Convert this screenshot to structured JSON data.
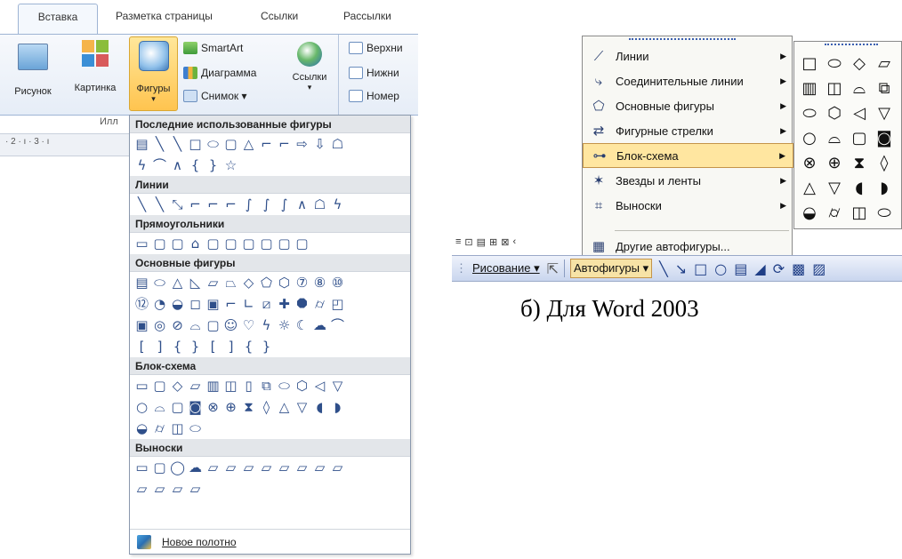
{
  "word2007": {
    "tabs": [
      "Вставка",
      "Разметка страницы",
      "Ссылки",
      "Рассылки"
    ],
    "ribbon": {
      "picture": "Рисунок",
      "clipart": "Картинка",
      "shapes": "Фигуры",
      "smartart": "SmartArt",
      "chart": "Диаграмма",
      "screenshot": "Снимок ▾",
      "links": "Ссылки",
      "header": "Верхни",
      "footer": "Нижни",
      "page_number": "Номер",
      "group_label": "Илл"
    },
    "ruler": "· 2 · ı · 3 · ı",
    "gallery": {
      "sections": [
        {
          "title": "Последние использованные фигуры",
          "rows": [
            [
              "▤",
              "╲",
              "╲",
              "□",
              "⬭",
              "▢",
              "△",
              "⌐",
              "⌐",
              "⇨",
              "⇩",
              "☖"
            ],
            [
              "ϟ",
              "⌒",
              "∧",
              "{",
              "}",
              "☆"
            ]
          ]
        },
        {
          "title": "Линии",
          "rows": [
            [
              "╲",
              "╲",
              "⤡",
              "⌐",
              "⌐",
              "⌐",
              "∫",
              "∫",
              "∫",
              "∧",
              "☖",
              "ϟ"
            ]
          ]
        },
        {
          "title": "Прямоугольники",
          "rows": [
            [
              "▭",
              "▢",
              "▢",
              "⌂",
              "▢",
              "▢",
              "▢",
              "▢",
              "▢",
              "▢"
            ]
          ]
        },
        {
          "title": "Основные фигуры",
          "rows": [
            [
              "▤",
              "⬭",
              "△",
              "◺",
              "▱",
              "⏢",
              "◇",
              "⬠",
              "⬡",
              "⑦",
              "⑧",
              "⑩"
            ],
            [
              "⑫",
              "◔",
              "◒",
              "◻",
              "▣",
              "⌐",
              "∟",
              "⧄",
              "✚",
              "⯃",
              "⌭",
              "◰"
            ],
            [
              "▣",
              "◎",
              "⊘",
              "⌓",
              "▢",
              "☺",
              "♡",
              "ϟ",
              "☼",
              "☾",
              "☁",
              "⌒"
            ],
            [
              "[",
              "]",
              "{",
              "}",
              "[",
              "]",
              "{",
              "}"
            ]
          ]
        },
        {
          "title": "Блок-схема",
          "rows": [
            [
              "▭",
              "▢",
              "◇",
              "▱",
              "▥",
              "◫",
              "▯",
              "⧉",
              "⬭",
              "⬡",
              "◁",
              "▽"
            ],
            [
              "○",
              "⌓",
              "▢",
              "◙",
              "⊗",
              "⊕",
              "⧗",
              "◊",
              "△",
              "▽",
              "◖",
              "◗"
            ],
            [
              "◒",
              "⌭",
              "◫",
              "⬭"
            ]
          ]
        },
        {
          "title": "Выноски",
          "rows": [
            [
              "▭",
              "▢",
              "◯",
              "☁",
              "⏥",
              "⏥",
              "⏥",
              "⏥",
              "⏥",
              "⏥",
              "⏥",
              "⏥"
            ],
            [
              "⏥",
              "⏥",
              "⏥",
              "⏥"
            ]
          ]
        }
      ],
      "footer": "Новое полотно"
    }
  },
  "word2003": {
    "menu": [
      {
        "icon": "⟋",
        "label": "Линии",
        "has_sub": true
      },
      {
        "icon": "⤷",
        "label": "Соединительные линии",
        "has_sub": true
      },
      {
        "icon": "⬠",
        "label": "Основные фигуры",
        "has_sub": true
      },
      {
        "icon": "⇄",
        "label": "Фигурные стрелки",
        "has_sub": true
      },
      {
        "icon": "⊶",
        "label": "Блок-схема",
        "has_sub": true
      },
      {
        "icon": "✶",
        "label": "Звезды и ленты",
        "has_sub": true
      },
      {
        "icon": "⌗",
        "label": "Выноски",
        "has_sub": true
      },
      {
        "icon": "▦",
        "label": "Другие автофигуры...",
        "has_sub": false
      }
    ],
    "submenu": [
      [
        "□",
        "⬭",
        "◇",
        "▱"
      ],
      [
        "▥",
        "◫",
        "⌓",
        "⧉"
      ],
      [
        "⬭",
        "⬡",
        "◁",
        "▽"
      ],
      [
        "○",
        "⌓",
        "▢",
        "◙"
      ],
      [
        "⊗",
        "⊕",
        "⧗",
        "◊"
      ],
      [
        "△",
        "▽",
        "◖",
        "◗"
      ],
      [
        "◒",
        "⌭",
        "◫",
        "⬭"
      ]
    ],
    "toolbar_small": [
      "≡",
      "⊡",
      "▤",
      "⊞",
      "⊠",
      "‹"
    ],
    "drawing_bar": {
      "draw": "Рисование ▾",
      "autoshapes": "Автофигуры ▾",
      "icons": [
        "╲",
        "↘",
        "□",
        "○",
        "▤",
        "◢",
        "⟳",
        "▩",
        "▨"
      ]
    },
    "caption": "б) Для Word 2003"
  },
  "colors": {
    "shape_blue": "#2f4f8a",
    "highlight": "#ffe6a0",
    "ribbon_border": "#9eb4d4"
  }
}
